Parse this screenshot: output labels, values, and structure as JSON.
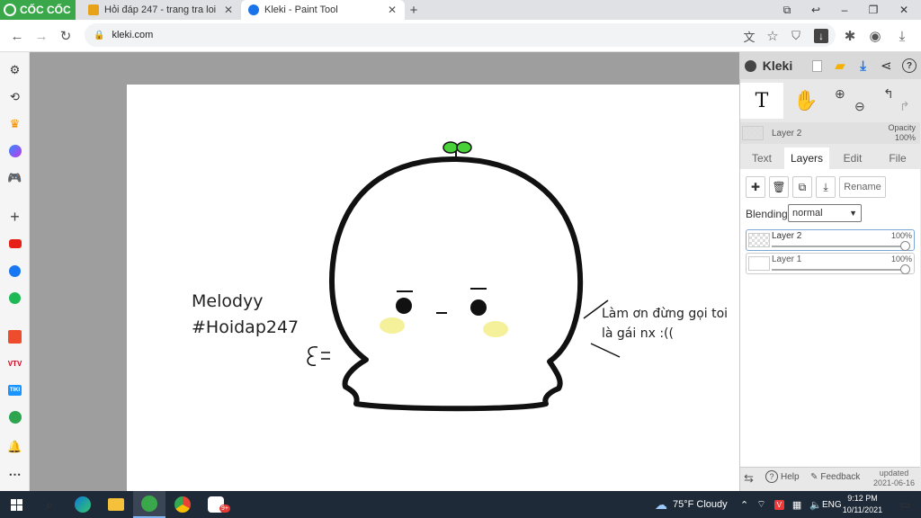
{
  "browser": {
    "brand_label": "CỐC CỐC",
    "tabs": [
      {
        "title": "Hỏi đáp 247 - trang tra loi",
        "favicon_color": "#e8a21a"
      },
      {
        "title": "Kleki - Paint Tool",
        "favicon_color": "#1a73e8"
      }
    ],
    "url": "kleki.com",
    "window_icons": [
      "screenshot-icon",
      "back-small-icon",
      "restore-icon",
      "close-icon"
    ],
    "nav_icons": [
      "back-icon",
      "forward-icon",
      "reload-icon"
    ],
    "toolbar_icons": [
      "translate-icon",
      "star-icon",
      "shield-icon",
      "download-arrow-icon",
      "extensions-icon",
      "profile-icon",
      "downloads-icon"
    ]
  },
  "sidebar": {
    "icons": [
      "settings-icon",
      "history-icon",
      "crown-icon",
      "messenger-icon",
      "game-icon",
      "add-icon",
      "youtube-icon",
      "facebook-icon",
      "spotify-icon",
      "shopee-icon",
      "vtv-icon",
      "tiki-icon",
      "football-icon",
      "bell-icon",
      "more-icon"
    ],
    "labels": {
      "vtv": "VTV",
      "tiki": "TIKI"
    }
  },
  "drawing": {
    "left_text_1": "Melodyy",
    "left_text_2": "#Hoidap247",
    "right_text_1": "Làm ơn đừng gọi toi",
    "right_text_2": "là gái nx :(("
  },
  "kleki": {
    "logo": "Kleki",
    "layer_name": "Layer 2",
    "opacity_label": "Opacity",
    "opacity_value": "100%",
    "tabs": [
      "Text",
      "Layers",
      "Edit",
      "File"
    ],
    "active_tab": "Layers",
    "rename_label": "Rename",
    "blending_label": "Blending",
    "blending_value": "normal",
    "layers": [
      {
        "name": "Layer 2",
        "opacity": "100%",
        "selected": true
      },
      {
        "name": "Layer 1",
        "opacity": "100%",
        "selected": false
      }
    ],
    "help_label": "Help",
    "feedback_label": "Feedback",
    "updated_label": "updated",
    "updated_date": "2021-06-16"
  },
  "taskbar": {
    "weather": "75°F  Cloudy",
    "language": "ENG",
    "time": "9:12 PM",
    "date": "10/11/2021",
    "badge": "9+"
  }
}
